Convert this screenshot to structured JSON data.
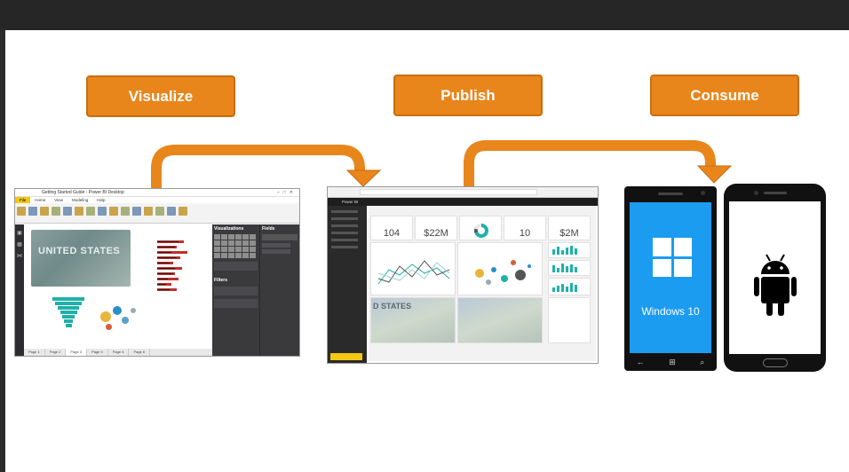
{
  "steps": [
    {
      "label": "Visualize"
    },
    {
      "label": "Publish"
    },
    {
      "label": "Consume"
    }
  ],
  "colors": {
    "step_fill": "#e8861c",
    "step_border": "#c96e0c",
    "arrow": "#e8861c",
    "windows_blue": "#1c9cf0",
    "pbi_yellow": "#f2c811",
    "teal": "#1fb1a9"
  },
  "desktop": {
    "title": "Getting Started Guide - Power BI Desktop",
    "tabs": [
      "File",
      "Home",
      "View",
      "Modeling",
      "Help"
    ],
    "map_label": "UNITED STATES",
    "viz_header": "Visualizations",
    "fields_header": "Fields",
    "filters_header": "Filters",
    "pages": [
      "Page 1",
      "Page 2",
      "Page 3",
      "Page 4",
      "Page 5",
      "Page 6"
    ]
  },
  "service": {
    "app_name": "Power BI",
    "tiles": [
      {
        "value": "104"
      },
      {
        "value": "$22M"
      },
      {
        "value": "10"
      },
      {
        "value": "$2M"
      }
    ],
    "map_label": "D STATES"
  },
  "windows_phone": {
    "os_label": "Windows 10",
    "icons": [
      "windows-logo-icon",
      "back-icon",
      "start-icon",
      "search-icon"
    ]
  },
  "android_phone": {
    "icons": [
      "android-robot-icon"
    ]
  }
}
